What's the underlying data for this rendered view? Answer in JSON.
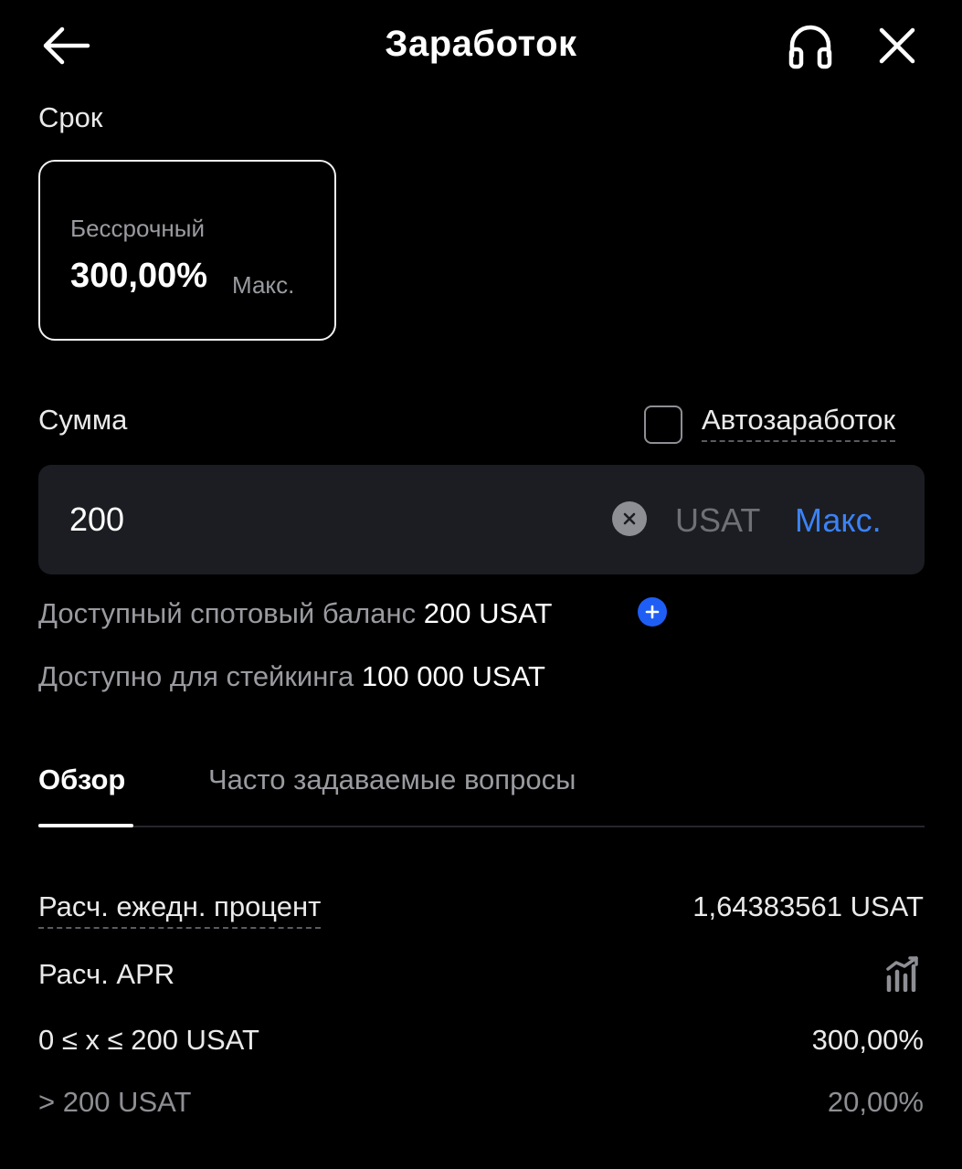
{
  "header": {
    "title": "Заработок",
    "back_icon": "arrow-left-icon",
    "support_icon": "headphones-icon",
    "close_icon": "close-icon"
  },
  "term": {
    "label": "Срок",
    "card": {
      "name": "Бессрочный",
      "rate": "300,00%",
      "max": "Макс."
    }
  },
  "amount": {
    "label": "Сумма",
    "auto_label": "Автозаработок",
    "auto_checked": false,
    "value": "200",
    "currency": "USAT",
    "max_label": "Макс."
  },
  "balances": {
    "spot_label": "Доступный спотовый баланс",
    "spot_value": "200 USAT",
    "staking_label": "Доступно для стейкинга",
    "staking_value": "100 000 USAT"
  },
  "tabs": [
    {
      "label": "Обзор",
      "active": true
    },
    {
      "label": "Часто задаваемые вопросы",
      "active": false
    }
  ],
  "overview": {
    "daily_label": "Расч. ежедн. процент",
    "daily_value": "1,64383561 USAT",
    "apr_label": "Расч. APR",
    "tiers": [
      {
        "range": "0 ≤ x ≤ 200 USAT",
        "rate": "300,00%"
      },
      {
        "range": "> 200 USAT",
        "rate": "20,00%"
      }
    ]
  },
  "colors": {
    "background": "#000000",
    "input_bg": "#1c1d22",
    "accent": "#3b82f6",
    "muted": "#9a9ba0"
  }
}
